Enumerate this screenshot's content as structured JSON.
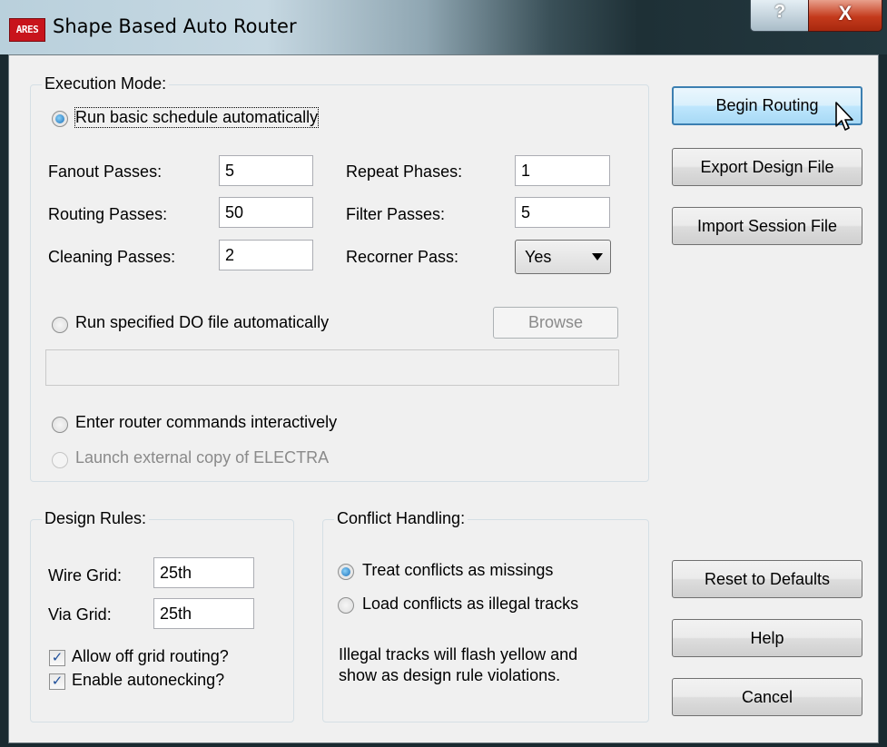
{
  "window": {
    "title": "Shape Based Auto Router",
    "app_icon_text": "ARES",
    "help_glyph": "?",
    "close_glyph": "X"
  },
  "execution_mode": {
    "label": "Execution Mode:",
    "run_basic_label": "Run basic schedule automatically",
    "fields": {
      "fanout_label": "Fanout Passes:",
      "fanout_value": "5",
      "routing_label": "Routing Passes:",
      "routing_value": "50",
      "cleaning_label": "Cleaning Passes:",
      "cleaning_value": "2",
      "repeat_label": "Repeat Phases:",
      "repeat_value": "1",
      "filter_label": "Filter Passes:",
      "filter_value": "5",
      "recorner_label": "Recorner Pass:",
      "recorner_value": "Yes"
    },
    "run_do_label": "Run specified DO file automatically",
    "browse_label": "Browse",
    "do_file_value": "",
    "interactive_label": "Enter router commands interactively",
    "launch_label": "Launch external copy of ELECTRA"
  },
  "design_rules": {
    "label": "Design Rules:",
    "wire_grid_label": "Wire Grid:",
    "wire_grid_value": "25th",
    "via_grid_label": "Via Grid:",
    "via_grid_value": "25th",
    "off_grid_label": "Allow off grid routing?",
    "autonecking_label": "Enable autonecking?",
    "off_grid_checked": true,
    "autonecking_checked": true
  },
  "conflict_handling": {
    "label": "Conflict Handling:",
    "treat_label": "Treat conflicts as missings",
    "load_label": "Load conflicts as illegal tracks",
    "note_line1": "Illegal tracks will flash yellow and",
    "note_line2": "show as design rule violations."
  },
  "buttons": {
    "begin": "Begin Routing",
    "export": "Export Design File",
    "import": "Import Session File",
    "reset": "Reset to Defaults",
    "help": "Help",
    "cancel": "Cancel"
  },
  "check_glyph": "✓"
}
